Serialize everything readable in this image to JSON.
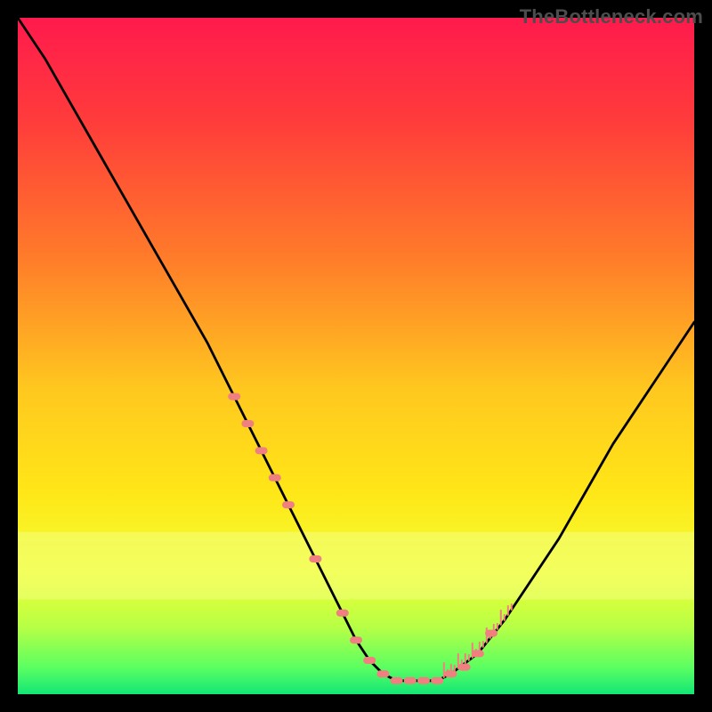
{
  "watermark": "TheBottleneck.com",
  "colors": {
    "gradient_stops": [
      {
        "offset": 0.0,
        "color": "#ff1a4d"
      },
      {
        "offset": 0.15,
        "color": "#ff3b3b"
      },
      {
        "offset": 0.35,
        "color": "#ff7a2a"
      },
      {
        "offset": 0.55,
        "color": "#ffc81f"
      },
      {
        "offset": 0.7,
        "color": "#ffe617"
      },
      {
        "offset": 0.82,
        "color": "#f3ff33"
      },
      {
        "offset": 0.9,
        "color": "#b8ff45"
      },
      {
        "offset": 0.96,
        "color": "#5cff61"
      },
      {
        "offset": 1.0,
        "color": "#12e676"
      }
    ],
    "curve": "#000000",
    "markers": "#f08080",
    "overlay_band": "#f2ff80"
  },
  "chart_data": {
    "type": "line",
    "title": "",
    "xlabel": "",
    "ylabel": "",
    "xlim": [
      0,
      100
    ],
    "ylim": [
      0,
      100
    ],
    "series": [
      {
        "name": "bottleneck-curve",
        "x": [
          0,
          4,
          8,
          12,
          16,
          20,
          24,
          28,
          32,
          36,
          40,
          44,
          48,
          50,
          52,
          54,
          56,
          58,
          60,
          62,
          64,
          68,
          72,
          76,
          80,
          84,
          88,
          92,
          96,
          100
        ],
        "values": [
          100,
          94,
          87,
          80,
          73,
          66,
          59,
          52,
          44,
          36,
          28,
          20,
          12,
          8,
          5,
          3,
          2,
          2,
          2,
          2,
          3,
          6,
          11,
          17,
          23,
          30,
          37,
          43,
          49,
          55
        ]
      }
    ],
    "markers": {
      "name": "highlight-points",
      "x": [
        32,
        34,
        36,
        38,
        40,
        44,
        48,
        50,
        52,
        54,
        56,
        58,
        60,
        62,
        64,
        66,
        68,
        70
      ],
      "values": [
        44,
        40,
        36,
        32,
        28,
        20,
        12,
        8,
        5,
        3,
        2,
        2,
        2,
        2,
        3,
        4,
        6,
        9
      ]
    },
    "ticks_right_band": {
      "x_start": 63,
      "x_end": 73,
      "count": 20
    },
    "overlay_band_y": [
      14,
      24
    ]
  }
}
